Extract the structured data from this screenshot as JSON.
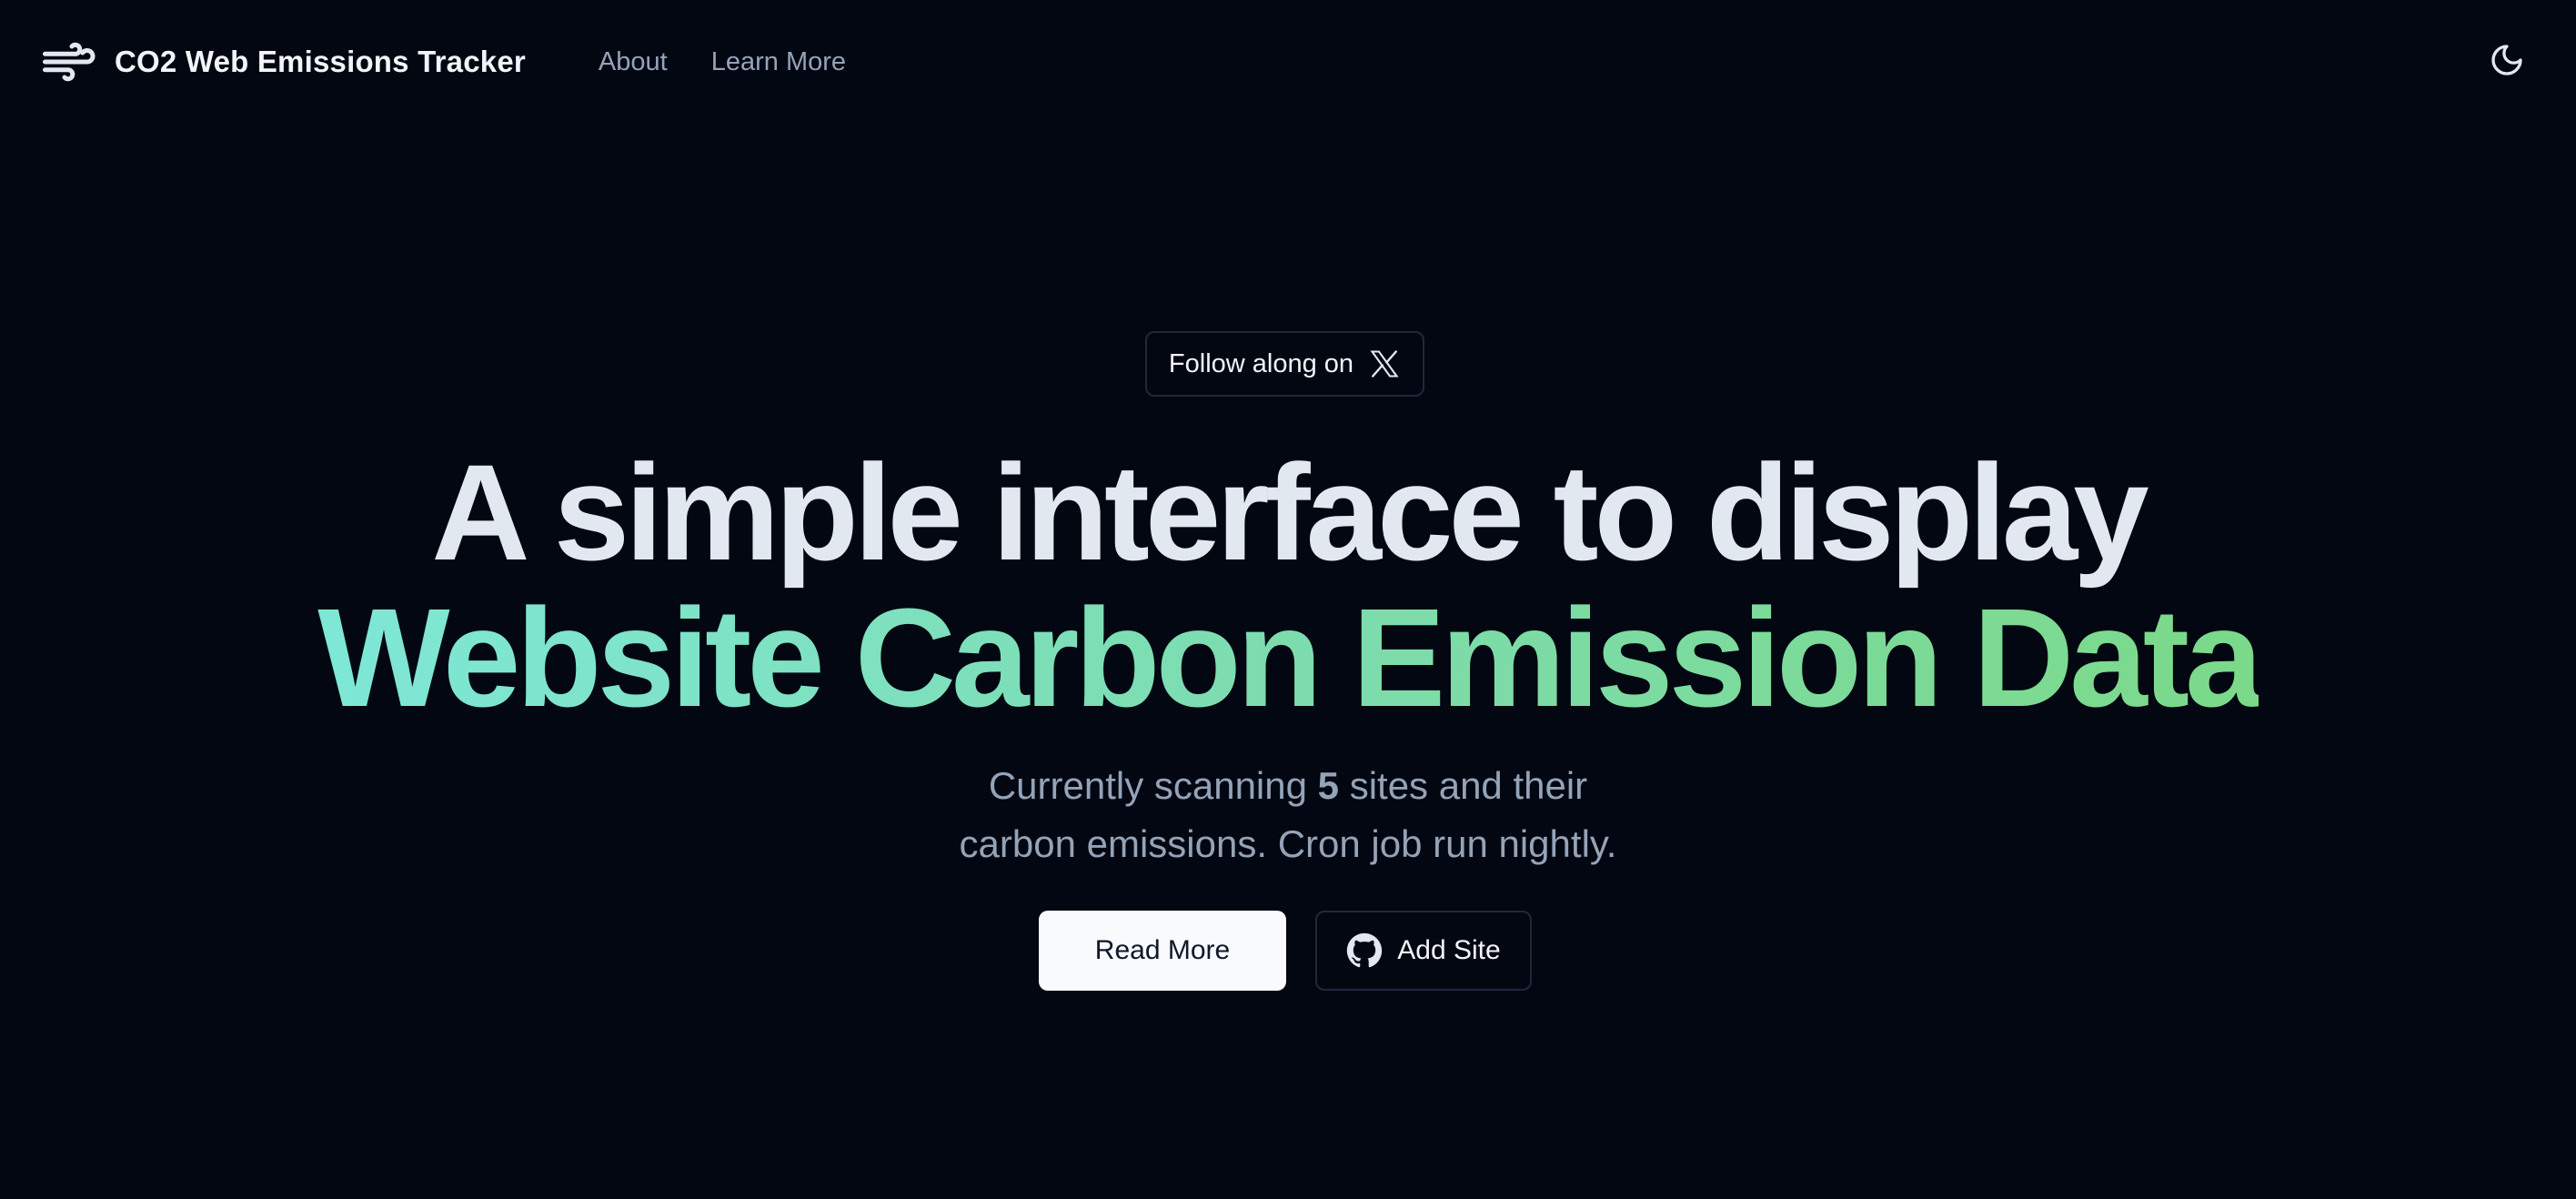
{
  "header": {
    "brand_icon": "wind-icon",
    "title": "CO2 Web Emissions Tracker",
    "nav": [
      {
        "label": "About"
      },
      {
        "label": "Learn More"
      }
    ],
    "theme_toggle_icon": "moon-icon"
  },
  "hero": {
    "follow_pill": {
      "label": "Follow along on",
      "icon": "x-logo-icon"
    },
    "headline_line1": "A simple interface to display",
    "headline_line2": "Website Carbon Emission Data",
    "subtext": {
      "prefix": "Currently scanning",
      "count": "5",
      "suffix": "sites and their",
      "line2": "carbon emissions. Cron job run nightly."
    },
    "buttons": {
      "read_more": "Read More",
      "add_site": "Add Site",
      "add_site_icon": "github-icon"
    }
  },
  "colors": {
    "background": "#030711",
    "text_primary": "#e2e8f0",
    "text_muted": "#94a3b8",
    "gradient_start": "#7ee7d6",
    "gradient_end": "#7bd98a",
    "border": "#1e293b"
  }
}
